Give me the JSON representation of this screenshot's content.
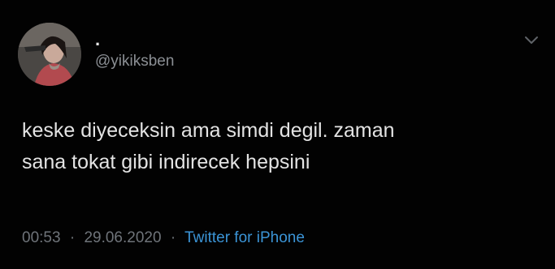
{
  "tweet": {
    "display_name": ".",
    "handle": "@yikiksben",
    "text_line1": "keske diyeceksin ama simdi degil. zaman",
    "text_line2": "sana tokat gibi indirecek hepsini",
    "time": "00:53",
    "date": "29.06.2020",
    "separator": "·",
    "source": "Twitter for iPhone"
  },
  "icons": {
    "avatar": "profile-photo",
    "chevron": "chevron-down-icon"
  },
  "colors": {
    "background": "#020202",
    "text": "#e3e3e3",
    "muted": "#6f747a",
    "link": "#3b94d6"
  }
}
